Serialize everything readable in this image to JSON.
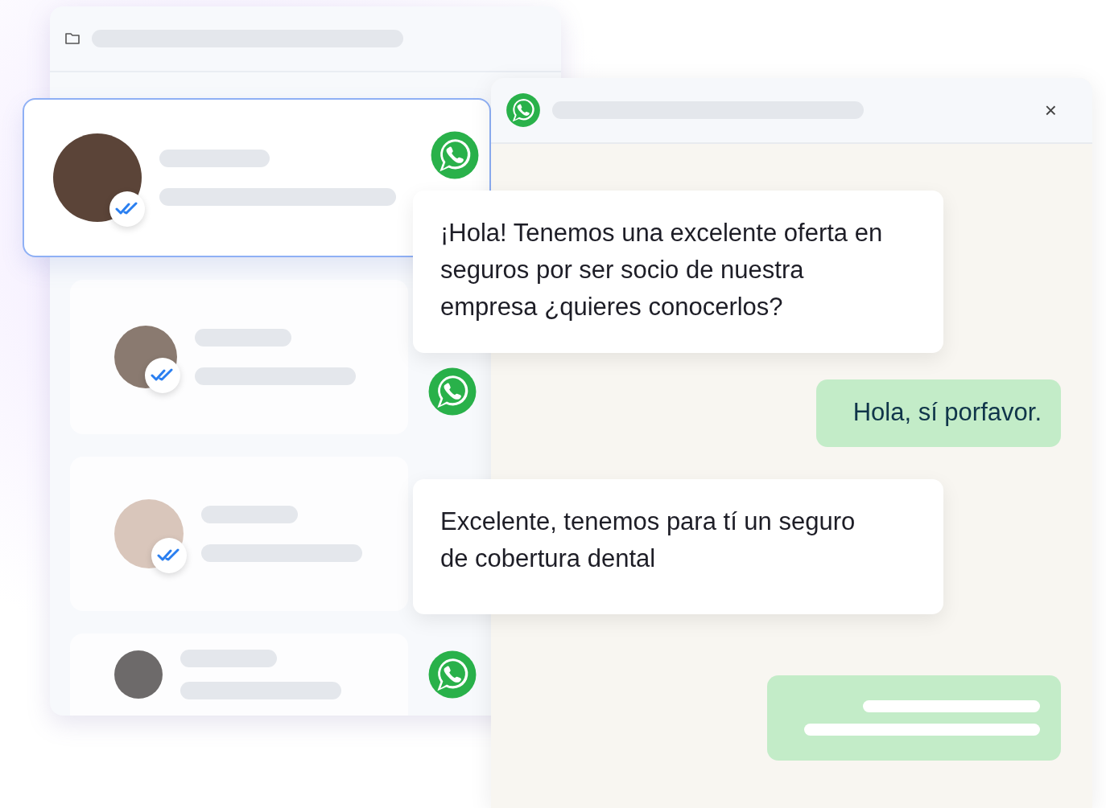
{
  "contacts": [
    {
      "selected": true
    },
    {
      "selected": false
    },
    {
      "selected": false
    },
    {
      "selected": false
    }
  ],
  "chat": {
    "close": "×",
    "messages": [
      {
        "kind": "incoming",
        "text": "¡Hola! Tenemos una excelente oferta en seguros por ser socio de nuestra empresa ¿quieres conocerlos?"
      },
      {
        "kind": "outgoing",
        "text": "Hola, sí porfavor."
      },
      {
        "kind": "incoming",
        "text": "Excelente, tenemos para tí un seguro de cobertura dental"
      },
      {
        "kind": "outgoing-skeleton"
      }
    ]
  }
}
